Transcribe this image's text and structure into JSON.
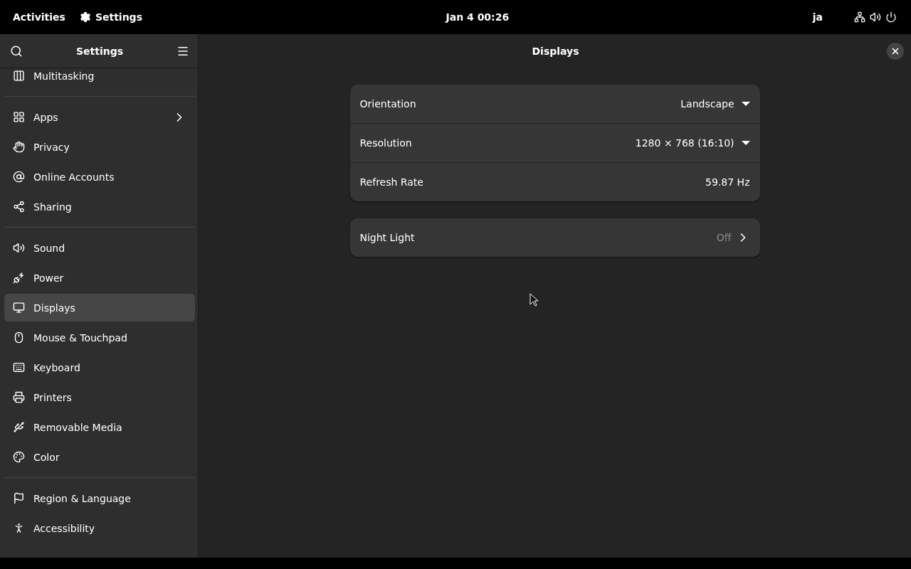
{
  "top_bar": {
    "activities": "Activities",
    "app_name": "Settings",
    "clock": "Jan 4  00:26",
    "input_method": "ja"
  },
  "sidebar": {
    "title": "Settings",
    "groups": [
      [
        {
          "label": "Multitasking",
          "selected": false,
          "submenu": false
        }
      ],
      [
        {
          "label": "Apps",
          "selected": false,
          "submenu": true
        },
        {
          "label": "Privacy",
          "selected": false,
          "submenu": false
        },
        {
          "label": "Online Accounts",
          "selected": false,
          "submenu": false
        },
        {
          "label": "Sharing",
          "selected": false,
          "submenu": false
        }
      ],
      [
        {
          "label": "Sound",
          "selected": false,
          "submenu": false
        },
        {
          "label": "Power",
          "selected": false,
          "submenu": false
        },
        {
          "label": "Displays",
          "selected": true,
          "submenu": false
        },
        {
          "label": "Mouse & Touchpad",
          "selected": false,
          "submenu": false
        },
        {
          "label": "Keyboard",
          "selected": false,
          "submenu": false
        },
        {
          "label": "Printers",
          "selected": false,
          "submenu": false
        },
        {
          "label": "Removable Media",
          "selected": false,
          "submenu": false
        },
        {
          "label": "Color",
          "selected": false,
          "submenu": false
        }
      ],
      [
        {
          "label": "Region & Language",
          "selected": false,
          "submenu": false
        },
        {
          "label": "Accessibility",
          "selected": false,
          "submenu": false
        }
      ]
    ]
  },
  "page": {
    "title": "Displays",
    "cards": [
      [
        {
          "kind": "dropdown",
          "label": "Orientation",
          "value": "Landscape"
        },
        {
          "kind": "dropdown",
          "label": "Resolution",
          "value": "1280 × 768 (16:10)"
        },
        {
          "kind": "value",
          "label": "Refresh Rate",
          "value": "59.87 Hz"
        }
      ],
      [
        {
          "kind": "link",
          "label": "Night Light",
          "value": "Off"
        }
      ]
    ]
  }
}
